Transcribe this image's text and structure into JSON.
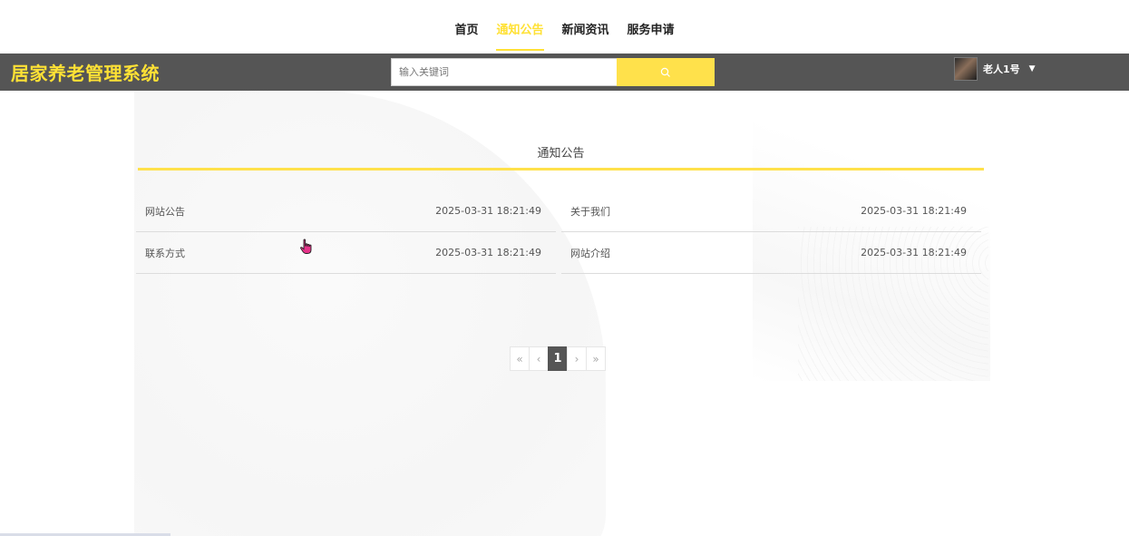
{
  "nav": {
    "items": [
      {
        "label": "首页",
        "active": false
      },
      {
        "label": "通知公告",
        "active": true
      },
      {
        "label": "新闻资讯",
        "active": false
      },
      {
        "label": "服务申请",
        "active": false
      }
    ]
  },
  "header": {
    "brand": "居家养老管理系统",
    "search_placeholder": "输入关键词",
    "user_name": "老人1号"
  },
  "main": {
    "title": "通知公告",
    "items": [
      {
        "title": "网站公告",
        "date": "2025-03-31 18:21:49"
      },
      {
        "title": "关于我们",
        "date": "2025-03-31 18:21:49"
      },
      {
        "title": "联系方式",
        "date": "2025-03-31 18:21:49"
      },
      {
        "title": "网站介绍",
        "date": "2025-03-31 18:21:49"
      }
    ]
  },
  "pagination": {
    "first": "«",
    "prev": "‹",
    "current": "1",
    "next": "›",
    "last": "»"
  },
  "colors": {
    "accent": "#ffe135",
    "header_bg": "#555555"
  }
}
